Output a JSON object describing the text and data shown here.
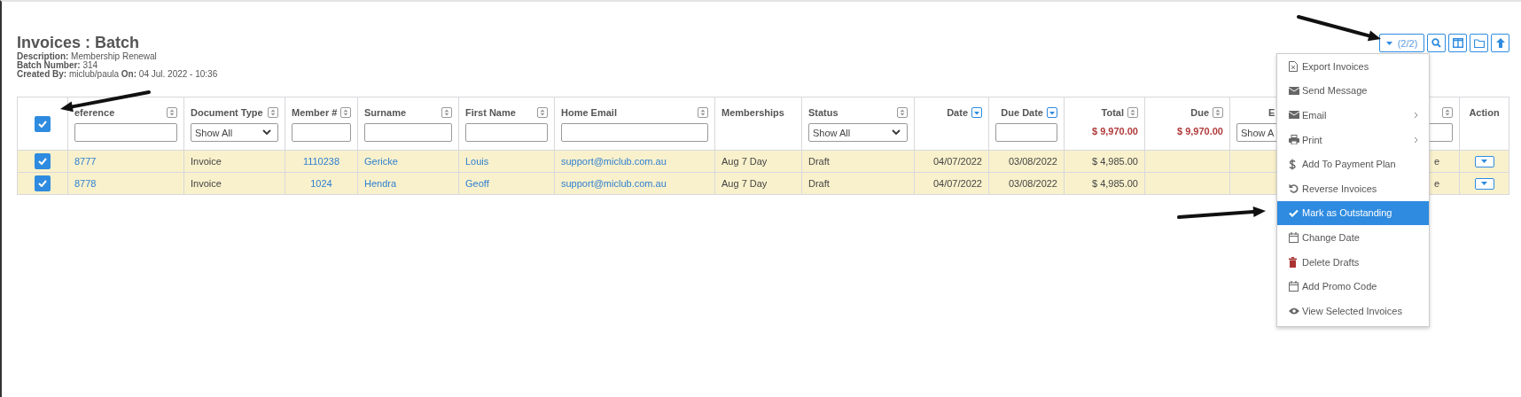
{
  "page": {
    "title": "Invoices : Batch",
    "details": [
      "**Description:** Membership Renewal",
      "**Batch Number:** 314",
      "**Created By:** miclub/paula **On:** 04 Jul. 2022 - 10:36"
    ]
  },
  "toolbar": {
    "selection_button": "(2/2)"
  },
  "table": {
    "select_all_checked": true,
    "columns": [
      {
        "label": "eference",
        "kind": "link",
        "sortable": true,
        "sorted": false,
        "filter": {
          "kind": "text"
        }
      },
      {
        "label": "Document Type",
        "kind": "text",
        "sortable": true,
        "sorted": false,
        "filter": {
          "kind": "select",
          "value": "Show All"
        }
      },
      {
        "label": "Member #",
        "kind": "link",
        "sortable": true,
        "sorted": false,
        "filter": {
          "kind": "text"
        }
      },
      {
        "label": "Surname",
        "kind": "link",
        "sortable": true,
        "sorted": false,
        "filter": {
          "kind": "text"
        }
      },
      {
        "label": "First Name",
        "kind": "link",
        "sortable": true,
        "sorted": false,
        "filter": {
          "kind": "text"
        }
      },
      {
        "label": "Home Email",
        "kind": "link",
        "sortable": true,
        "sorted": false,
        "filter": {
          "kind": "text"
        }
      },
      {
        "label": "Memberships",
        "kind": "text",
        "sortable": false
      },
      {
        "label": "Status",
        "kind": "text",
        "sortable": true,
        "sorted": false,
        "filter": {
          "kind": "select",
          "value": "Show All"
        }
      },
      {
        "label": "Date",
        "kind": "text",
        "sortable": true,
        "sorted": true
      },
      {
        "label": "Due Date",
        "kind": "text",
        "sortable": true,
        "sorted": true,
        "filter": {
          "kind": "text"
        }
      },
      {
        "label": "Total",
        "kind": "text",
        "sortable": true,
        "sorted": false,
        "total": "$ 9,970.00"
      },
      {
        "label": "Due",
        "kind": "text",
        "sortable": true,
        "sorted": false,
        "total": "$ 9,970.00"
      },
      {
        "label": "E",
        "kind": "text",
        "sortable": false,
        "filter": {
          "kind": "select",
          "value": "Show A"
        }
      },
      {
        "kind": "text",
        "sortable": true,
        "sorted": false,
        "filter": {
          "kind": "text"
        }
      },
      {
        "label": "Action",
        "kind": "action",
        "sortable": false
      }
    ],
    "rows": [
      {
        "checked": true,
        "cells": [
          "8777",
          "Invoice",
          "1110238",
          "Gericke",
          "Louis",
          "support@miclub.com.au",
          "Aug 7 Day",
          "Draft",
          "04/07/2022",
          "03/08/2022",
          "$ 4,985.00",
          null,
          null,
          "e",
          null
        ]
      },
      {
        "checked": true,
        "cells": [
          "8778",
          "Invoice",
          "1024",
          "Hendra",
          "Geoff",
          "support@miclub.com.au",
          "Aug 7 Day",
          "Draft",
          "04/07/2022",
          "03/08/2022",
          "$ 4,985.00",
          null,
          null,
          "e",
          null
        ]
      }
    ]
  },
  "menu": {
    "items": [
      {
        "label": "Export Invoices",
        "selected": false,
        "submenu": false
      },
      {
        "label": "Send Message",
        "selected": false,
        "submenu": false
      },
      {
        "label": "Email",
        "selected": false,
        "submenu": true
      },
      {
        "label": "Print",
        "selected": false,
        "submenu": true
      },
      {
        "label": "Add To Payment Plan",
        "selected": false,
        "submenu": false
      },
      {
        "label": "Reverse Invoices",
        "selected": false,
        "submenu": false
      },
      {
        "label": "Mark as Outstanding",
        "selected": true,
        "submenu": false
      },
      {
        "label": "Change Date",
        "selected": false,
        "submenu": false
      },
      {
        "label": "Delete Drafts",
        "selected": false,
        "submenu": false
      },
      {
        "label": "Add Promo Code",
        "selected": false,
        "submenu": false
      },
      {
        "label": "View Selected Invoices",
        "selected": false,
        "submenu": false
      }
    ]
  }
}
